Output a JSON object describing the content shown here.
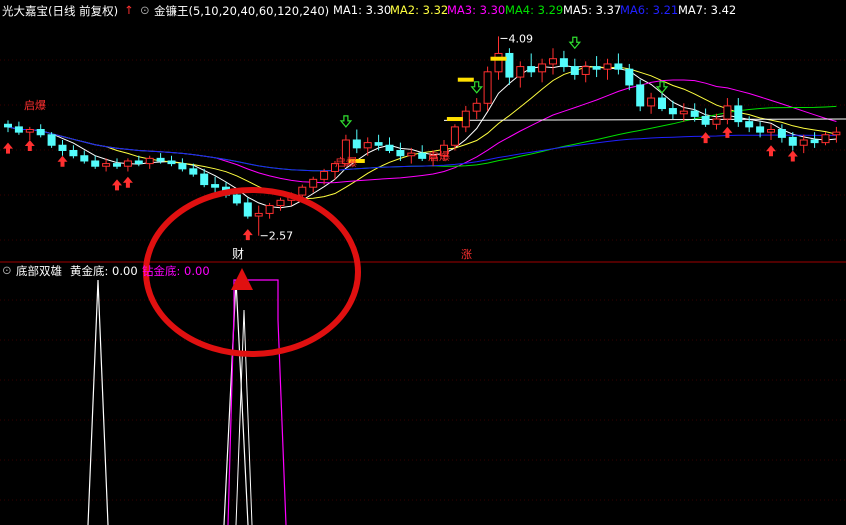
{
  "header": {
    "stock_title": "光大嘉宝(日线 前复权)",
    "indicator_name": "金镰王(5,10,20,40,60,120,240)",
    "ma_items": [
      {
        "label": "MA1: 3.30",
        "color": "#ffffff"
      },
      {
        "label": "MA2: 3.32",
        "color": "#ffff40"
      },
      {
        "label": "MA3: 3.30",
        "color": "#ff00ff"
      },
      {
        "label": "MA4: 3.29",
        "color": "#00e000"
      },
      {
        "label": "MA5: 3.37",
        "color": "#ffffff"
      },
      {
        "label": "MA6: 3.21",
        "color": "#2020ff"
      },
      {
        "label": "MA7: 3.42",
        "color": "#ffffff"
      }
    ]
  },
  "lower_panel": {
    "title": "底部双雄",
    "line1": "黄金底: 0.00",
    "line2": "钻金底: 0.00"
  },
  "annotations": {
    "high_label": "4.09",
    "low_label": "2.57",
    "zhang": "涨",
    "cai": "财",
    "baoqi": "启爆",
    "qibao2": "启爆",
    "qibao3": "启爆"
  },
  "colors": {
    "up": "#ff3030",
    "down": "#54fcfc",
    "ellipse": "#e01010"
  },
  "chart_data": {
    "type": "candlestick",
    "title": "金镰王(5,10,20,40,60,120,240)",
    "ylim": [
      2.4,
      4.2
    ],
    "candles": [
      [
        3.42,
        3.45,
        3.36,
        3.4
      ],
      [
        3.4,
        3.44,
        3.34,
        3.36
      ],
      [
        3.36,
        3.4,
        3.3,
        3.38
      ],
      [
        3.38,
        3.42,
        3.32,
        3.34
      ],
      [
        3.34,
        3.36,
        3.24,
        3.26
      ],
      [
        3.26,
        3.3,
        3.18,
        3.22
      ],
      [
        3.22,
        3.26,
        3.16,
        3.18
      ],
      [
        3.18,
        3.22,
        3.12,
        3.14
      ],
      [
        3.14,
        3.18,
        3.08,
        3.1
      ],
      [
        3.1,
        3.16,
        3.06,
        3.12
      ],
      [
        3.12,
        3.16,
        3.08,
        3.1
      ],
      [
        3.1,
        3.16,
        3.06,
        3.14
      ],
      [
        3.14,
        3.18,
        3.1,
        3.12
      ],
      [
        3.12,
        3.18,
        3.08,
        3.16
      ],
      [
        3.16,
        3.2,
        3.12,
        3.14
      ],
      [
        3.14,
        3.18,
        3.1,
        3.12
      ],
      [
        3.12,
        3.16,
        3.06,
        3.08
      ],
      [
        3.08,
        3.12,
        3.02,
        3.04
      ],
      [
        3.04,
        3.08,
        2.94,
        2.96
      ],
      [
        2.96,
        3.02,
        2.9,
        2.94
      ],
      [
        2.94,
        2.98,
        2.86,
        2.88
      ],
      [
        2.88,
        2.92,
        2.8,
        2.82
      ],
      [
        2.82,
        2.86,
        2.7,
        2.72
      ],
      [
        2.72,
        2.8,
        2.57,
        2.74
      ],
      [
        2.74,
        2.82,
        2.7,
        2.8
      ],
      [
        2.8,
        2.86,
        2.76,
        2.84
      ],
      [
        2.84,
        2.9,
        2.8,
        2.88
      ],
      [
        2.88,
        2.96,
        2.84,
        2.94
      ],
      [
        2.94,
        3.02,
        2.9,
        3.0
      ],
      [
        3.0,
        3.08,
        2.96,
        3.06
      ],
      [
        3.06,
        3.14,
        3.0,
        3.12
      ],
      [
        3.12,
        3.34,
        3.1,
        3.3
      ],
      [
        3.3,
        3.38,
        3.2,
        3.24
      ],
      [
        3.24,
        3.32,
        3.18,
        3.28
      ],
      [
        3.28,
        3.34,
        3.22,
        3.26
      ],
      [
        3.26,
        3.32,
        3.2,
        3.22
      ],
      [
        3.22,
        3.28,
        3.14,
        3.18
      ],
      [
        3.18,
        3.24,
        3.12,
        3.2
      ],
      [
        3.2,
        3.26,
        3.14,
        3.16
      ],
      [
        3.16,
        3.22,
        3.1,
        3.18
      ],
      [
        3.18,
        3.3,
        3.14,
        3.26
      ],
      [
        3.26,
        3.42,
        3.22,
        3.4
      ],
      [
        3.4,
        3.56,
        3.36,
        3.52
      ],
      [
        3.52,
        3.62,
        3.46,
        3.58
      ],
      [
        3.58,
        3.86,
        3.52,
        3.82
      ],
      [
        3.82,
        4.09,
        3.76,
        3.96
      ],
      [
        3.96,
        4.0,
        3.72,
        3.78
      ],
      [
        3.78,
        3.9,
        3.7,
        3.86
      ],
      [
        3.86,
        3.96,
        3.78,
        3.82
      ],
      [
        3.82,
        3.92,
        3.74,
        3.88
      ],
      [
        3.88,
        4.0,
        3.8,
        3.92
      ],
      [
        3.92,
        3.98,
        3.82,
        3.86
      ],
      [
        3.86,
        3.92,
        3.76,
        3.8
      ],
      [
        3.8,
        3.9,
        3.74,
        3.86
      ],
      [
        3.86,
        3.94,
        3.78,
        3.84
      ],
      [
        3.84,
        3.92,
        3.76,
        3.88
      ],
      [
        3.88,
        3.96,
        3.8,
        3.84
      ],
      [
        3.84,
        3.88,
        3.68,
        3.72
      ],
      [
        3.72,
        3.76,
        3.52,
        3.56
      ],
      [
        3.56,
        3.66,
        3.5,
        3.62
      ],
      [
        3.62,
        3.66,
        3.52,
        3.54
      ],
      [
        3.54,
        3.6,
        3.46,
        3.5
      ],
      [
        3.5,
        3.58,
        3.44,
        3.52
      ],
      [
        3.52,
        3.58,
        3.44,
        3.48
      ],
      [
        3.48,
        3.54,
        3.4,
        3.42
      ],
      [
        3.42,
        3.5,
        3.38,
        3.46
      ],
      [
        3.46,
        3.62,
        3.42,
        3.56
      ],
      [
        3.56,
        3.62,
        3.4,
        3.44
      ],
      [
        3.44,
        3.48,
        3.36,
        3.4
      ],
      [
        3.4,
        3.44,
        3.32,
        3.36
      ],
      [
        3.36,
        3.42,
        3.3,
        3.38
      ],
      [
        3.38,
        3.42,
        3.28,
        3.32
      ],
      [
        3.32,
        3.36,
        3.22,
        3.26
      ],
      [
        3.26,
        3.34,
        3.2,
        3.3
      ],
      [
        3.3,
        3.36,
        3.24,
        3.28
      ],
      [
        3.28,
        3.36,
        3.26,
        3.34
      ],
      [
        3.34,
        3.4,
        3.28,
        3.36
      ]
    ],
    "ma_lines": [
      {
        "name": "MA1",
        "color": "#ffffff"
      },
      {
        "name": "MA2",
        "color": "#ffff40"
      },
      {
        "name": "MA3",
        "color": "#ff00ff"
      },
      {
        "name": "MA4",
        "color": "#00e000"
      },
      {
        "name": "MA6",
        "color": "#2020ff"
      }
    ],
    "indicator": {
      "name": "底部双雄",
      "signals": [
        {
          "series": "黄金底",
          "x_index": 5,
          "value": 1.0
        },
        {
          "series": "钻金底",
          "x_index": 23,
          "value": 1.0
        }
      ]
    }
  }
}
